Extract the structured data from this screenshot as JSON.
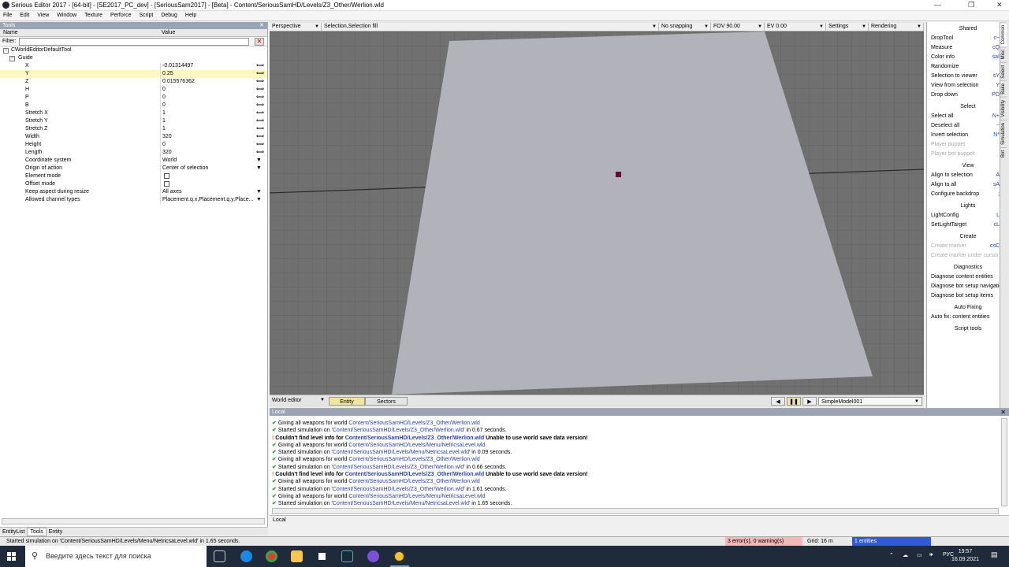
{
  "window": {
    "title": "Serious Editor 2017 - [64-bit] - [SE2017_PC_dev] - [SeriousSam2017] - [Beta] - Content/SeriousSamHD/Levels/Z3_Other/Werlion.wld",
    "minimize": "—",
    "maximize": "❐",
    "close": "✕"
  },
  "menu": [
    "File",
    "Edit",
    "View",
    "Window",
    "Texture",
    "Perforce",
    "Script",
    "Debug",
    "Help"
  ],
  "tools_panel": {
    "title": "Tools",
    "col_name": "Name",
    "col_value": "Value",
    "filter_label": "Filter:",
    "filter_value": "",
    "tree_root": "CWorldEditorDefaultTool",
    "tree_group": "Guide",
    "properties": [
      {
        "name": "X",
        "value": "-0.01314497",
        "ctrl": "arrows"
      },
      {
        "name": "Y",
        "value": "0.25",
        "ctrl": "arrows",
        "highlight": true
      },
      {
        "name": "Z",
        "value": "0.015576362",
        "ctrl": "arrows"
      },
      {
        "name": "H",
        "value": "0",
        "ctrl": "arrows"
      },
      {
        "name": "P",
        "value": "0",
        "ctrl": "arrows"
      },
      {
        "name": "B",
        "value": "0",
        "ctrl": "arrows"
      },
      {
        "name": "Stretch X",
        "value": "1",
        "ctrl": "arrows"
      },
      {
        "name": "Stretch Y",
        "value": "1",
        "ctrl": "arrows"
      },
      {
        "name": "Stretch Z",
        "value": "1",
        "ctrl": "arrows"
      },
      {
        "name": "Width",
        "value": "320",
        "ctrl": "arrows"
      },
      {
        "name": "Height",
        "value": "0",
        "ctrl": "arrows"
      },
      {
        "name": "Length",
        "value": "320",
        "ctrl": "arrows"
      },
      {
        "name": "Coordinate system",
        "value": "World",
        "ctrl": "dropdown"
      },
      {
        "name": "Origin of action",
        "value": "Center of selection",
        "ctrl": "dropdown"
      },
      {
        "name": "Element mode",
        "value": "",
        "ctrl": "checkbox"
      },
      {
        "name": "Offset mode",
        "value": "",
        "ctrl": "checkbox"
      },
      {
        "name": "Keep aspect during resize",
        "value": "All axes",
        "ctrl": "dropdown"
      },
      {
        "name": "Allowed channel types",
        "value": "Placement.q.x,Placement.q.y,Place...",
        "ctrl": "dropdown"
      }
    ],
    "tabs": [
      "EntityList",
      "Tools",
      "Entity"
    ],
    "active_tab": "Tools"
  },
  "viewport_toolbar": [
    {
      "label": "Perspective"
    },
    {
      "label": "Selection,Selection fill"
    },
    {
      "label": "No snapping"
    },
    {
      "label": "FOV 90.00"
    },
    {
      "label": "EV  0.00"
    },
    {
      "label": "Settings"
    },
    {
      "label": "Rendering"
    }
  ],
  "viewport_bottom": {
    "mode": "World editor",
    "tabs": [
      "Entity",
      "Sectors"
    ],
    "active_tab": "Entity",
    "model": "SimpleModel001",
    "prev": "◀",
    "pause": "❚❚",
    "next": "▶"
  },
  "console": {
    "title": "Local",
    "lines": [
      {
        "type": "ok",
        "pre": "Giving all weapons for world ",
        "link": "Content/SeriousSamHD/Levels/Z3_Other/Werlion.wld",
        "post": ""
      },
      {
        "type": "ok",
        "pre": "Started simulation on '",
        "link": "Content/SeriousSamHD/Levels/Z3_Other/Werlion.wld",
        "post": "' in 0.67 seconds."
      },
      {
        "type": "warn",
        "pre": "Couldn't find level info for ",
        "link": "Content/SeriousSamHD/Levels/Z3_Other/Werlion.wld",
        "post": " Unable to use world save data version!"
      },
      {
        "type": "ok",
        "pre": "Giving all weapons for world ",
        "link": "Content/SeriousSamHD/Levels/Menu/NetricsaLevel.wld",
        "post": ""
      },
      {
        "type": "ok",
        "pre": "Started simulation on '",
        "link": "Content/SeriousSamHD/Levels/Menu/NetricsaLevel.wld",
        "post": "' in 0.09 seconds."
      },
      {
        "type": "ok",
        "pre": "Giving all weapons for world ",
        "link": "Content/SeriousSamHD/Levels/Z3_Other/Werlion.wld",
        "post": ""
      },
      {
        "type": "ok",
        "pre": "Started simulation on '",
        "link": "Content/SeriousSamHD/Levels/Z3_Other/Werlion.wld",
        "post": "' in 0.66 seconds."
      },
      {
        "type": "warn",
        "pre": "Couldn't find level info for ",
        "link": "Content/SeriousSamHD/Levels/Z3_Other/Werlion.wld",
        "post": " Unable to use world save data version!"
      },
      {
        "type": "ok",
        "pre": "Giving all weapons for world ",
        "link": "Content/SeriousSamHD/Levels/Z3_Other/Werlion.wld",
        "post": ""
      },
      {
        "type": "ok",
        "pre": "Started simulation on '",
        "link": "Content/SeriousSamHD/Levels/Z3_Other/Werlion.wld",
        "post": "' in 1.61 seconds."
      },
      {
        "type": "ok",
        "pre": "Giving all weapons for world ",
        "link": "Content/SeriousSamHD/Levels/Menu/NetricsaLevel.wld",
        "post": ""
      },
      {
        "type": "ok",
        "pre": "Started simulation on '",
        "link": "Content/SeriousSamHD/Levels/Menu/NetricsaLevel.wld",
        "post": "' in 1.65 seconds."
      }
    ],
    "input_label": "Local"
  },
  "right_panel": {
    "sections": [
      {
        "title": "Shared",
        "items": [
          {
            "label": "DropTool",
            "key": "c~"
          },
          {
            "label": "Measure",
            "key": "cQ"
          },
          {
            "label": "Color info",
            "key": "saI"
          },
          {
            "label": "Randomize",
            "key": ""
          },
          {
            "label": "Selection to viewer",
            "key": "sY"
          },
          {
            "label": "View from selection",
            "key": "Y"
          },
          {
            "label": "Drop down",
            "key": "PD"
          }
        ]
      },
      {
        "title": "Select",
        "items": [
          {
            "label": "Select all",
            "key": "N+"
          },
          {
            "label": "Deselect all",
            "key": "~"
          },
          {
            "label": "Invert selection",
            "key": "N*"
          },
          {
            "label": "Player puppet",
            "key": "",
            "disabled": true
          },
          {
            "label": "Player bot puppet",
            "key": "",
            "disabled": true
          }
        ]
      },
      {
        "title": "View",
        "items": [
          {
            "label": "Align to selection",
            "key": "A"
          },
          {
            "label": "Align to all",
            "key": "sA"
          },
          {
            "label": "Configure backdrop",
            "key": ";"
          }
        ]
      },
      {
        "title": "Lights",
        "items": [
          {
            "label": "LightConfig",
            "key": "L"
          },
          {
            "label": "SetLightTarget",
            "key": "cL"
          }
        ]
      },
      {
        "title": "Create",
        "items": [
          {
            "label": "Create marker",
            "key": "csC",
            "disabled": true
          },
          {
            "label": "Create marker under cursor",
            "key": "",
            "disabled": true
          }
        ]
      },
      {
        "title": "Diagnostics",
        "items": [
          {
            "label": "Diagnose content entities",
            "key": ""
          },
          {
            "label": "Diagnose bot setup navigation",
            "key": ""
          },
          {
            "label": "Diagnose bot setup items",
            "key": ""
          }
        ]
      },
      {
        "title": "Auto Fixing",
        "items": [
          {
            "label": "Auto fix: content entities",
            "key": ""
          }
        ]
      },
      {
        "title": "Script tools",
        "items": []
      }
    ],
    "tabs": [
      "Common",
      "Misc",
      "Select",
      "Bake",
      "Visibility",
      "Simulation",
      "Bot"
    ]
  },
  "statusbar": {
    "message": "Started simulation on 'Content/SeriousSamHD/Levels/Menu/NetricsaLevel.wld' in 1.65 seconds.",
    "errors": "3 error(s), 0 warning(s)",
    "grid": "Grid: 16 m",
    "entities": "1 entities"
  },
  "taskbar": {
    "search_placeholder": "Введите здесь текст для поиска",
    "lang": "РУС",
    "time": "19:57",
    "date": "16.09.2021"
  },
  "colors": {
    "error_bg": "#f4b8b8",
    "entities_bg": "#2f5bd6",
    "highlight_row": "#fff7c0",
    "plane": "#b2b2ba",
    "grid_bg": "#6e6e6e"
  }
}
